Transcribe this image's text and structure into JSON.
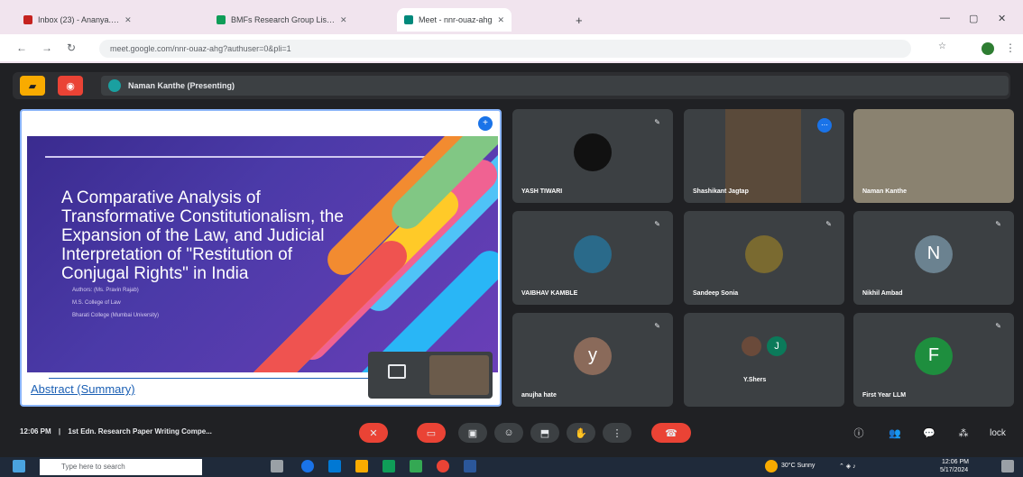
{
  "browser": {
    "tabs": [
      {
        "label": "Inbox (23) - Ananya.…",
        "fav_color": "#c5221f"
      },
      {
        "label": "BMFs Research Group Lis…",
        "fav_color": "#0f9d58"
      },
      {
        "label": "Meet - nnr-ouaz-ahg",
        "fav_color": "#00897b"
      }
    ],
    "new_tab": "+",
    "url": "meet.google.com/nnr-ouaz-ahg?authuser=0&pli=1",
    "nav": {
      "back": "←",
      "forward": "→",
      "reload": "↻"
    }
  },
  "meeting": {
    "presenter_label": "Naman Kanthe (Presenting)",
    "time": "12:06 PM",
    "separator": "|",
    "meeting_title": "1st Edn. Research Paper Writing Compe..."
  },
  "slide": {
    "title_lines": [
      "A Comparative Analysis of",
      "Transformative Constitutionalism, the",
      "Expansion of the Law, and Judicial",
      "Interpretation of \"Restitution of",
      "Conjugal Rights\" in India"
    ],
    "sub_lines": [
      "Authors: (Ms. Pravin Rajab)",
      "M.S. College of Law",
      "Bharati College (Mumbai University)"
    ],
    "abstract": "Abstract (Summary)"
  },
  "participants": [
    {
      "name": "YASH TIWARI",
      "initial": "",
      "color": "#202124"
    },
    {
      "name": "Shashikant Jagtap",
      "initial": "",
      "color": "#5a4a3a"
    },
    {
      "name": "Naman Kanthe",
      "initial": "",
      "color": "#8a8270"
    },
    {
      "name": "VAIBHAV KAMBLE",
      "initial": "",
      "color": "#2a6a8a"
    },
    {
      "name": "Sandeep Sonia",
      "initial": "",
      "color": "#7a6a30"
    },
    {
      "name": "Nikhil Ambad",
      "initial": "N",
      "color": "#6b8290"
    },
    {
      "name": "anujha hate",
      "initial": "y",
      "color": "#8a6a5a"
    },
    {
      "name": "Y.Shers",
      "initial": "J",
      "color": "#0b7a5a"
    },
    {
      "name": "First Year LLM",
      "initial": "F",
      "color": "#1e8e3e"
    }
  ],
  "controls": {
    "mic": "✕",
    "cam": "▭",
    "captions": "▣",
    "emoji": "☺",
    "present": "⬒",
    "hand": "✋",
    "more": "⋮",
    "end": "☎"
  },
  "right_tools": {
    "info": "ⓘ",
    "people": "👥",
    "chat": "💬",
    "activities": "⁂",
    "lock": "lock"
  },
  "taskbar": {
    "search_placeholder": "Type here to search",
    "weather": "30°C  Sunny",
    "clock_time": "12:06 PM",
    "clock_date": "5/17/2024"
  }
}
